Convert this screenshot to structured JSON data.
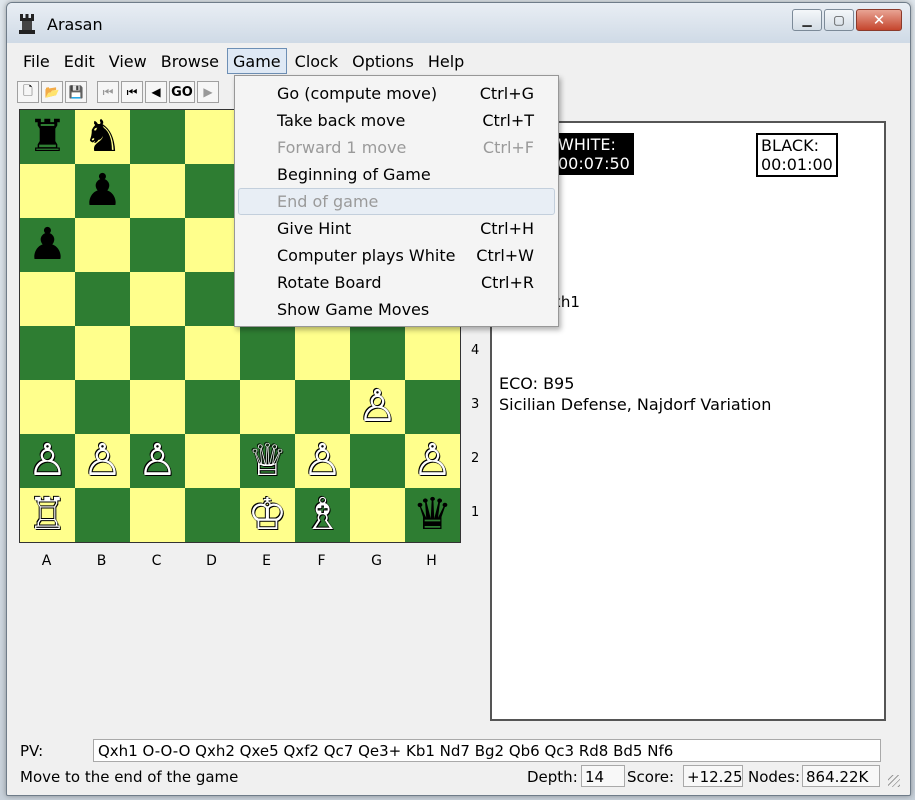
{
  "window": {
    "title": "Arasan"
  },
  "menu": {
    "file": "File",
    "edit": "Edit",
    "view": "View",
    "browse": "Browse",
    "game": "Game",
    "clock": "Clock",
    "options": "Options",
    "help": "Help"
  },
  "toolbar": {
    "go": "GO"
  },
  "game_menu": [
    {
      "label": "Go (compute move)",
      "shortcut": "Ctrl+G"
    },
    {
      "label": "Take back move",
      "shortcut": "Ctrl+T"
    },
    {
      "label": "Forward 1 move",
      "shortcut": "Ctrl+F"
    },
    {
      "label": "Beginning of Game",
      "shortcut": ""
    },
    {
      "label": "End of game",
      "shortcut": ""
    },
    {
      "label": "Give Hint",
      "shortcut": "Ctrl+H"
    },
    {
      "label": "Computer plays White",
      "shortcut": "Ctrl+W"
    },
    {
      "label": "Rotate Board",
      "shortcut": "Ctrl+R"
    },
    {
      "label": "Show Game Moves",
      "shortcut": ""
    }
  ],
  "board": {
    "files": [
      "A",
      "B",
      "C",
      "D",
      "E",
      "F",
      "G",
      "H"
    ],
    "visible_ranks": [
      "4",
      "3",
      "2",
      "1"
    ],
    "pieces": [
      {
        "square": "a8",
        "glyph": "♜",
        "color": "black"
      },
      {
        "square": "b8",
        "glyph": "♞",
        "color": "black"
      },
      {
        "square": "b7",
        "glyph": "♟",
        "color": "black"
      },
      {
        "square": "a6",
        "glyph": "♟",
        "color": "black"
      },
      {
        "square": "g3",
        "glyph": "♙",
        "color": "white"
      },
      {
        "square": "a2",
        "glyph": "♙",
        "color": "white"
      },
      {
        "square": "b2",
        "glyph": "♙",
        "color": "white"
      },
      {
        "square": "c2",
        "glyph": "♙",
        "color": "white"
      },
      {
        "square": "e2",
        "glyph": "♕",
        "color": "white"
      },
      {
        "square": "f2",
        "glyph": "♙",
        "color": "white"
      },
      {
        "square": "h2",
        "glyph": "♙",
        "color": "white"
      },
      {
        "square": "a1",
        "glyph": "♖",
        "color": "white"
      },
      {
        "square": "e1",
        "glyph": "♔",
        "color": "white"
      },
      {
        "square": "f1",
        "glyph": "♗",
        "color": "white"
      },
      {
        "square": "h1",
        "glyph": "♛",
        "color": "black"
      }
    ],
    "light_color": "#ffff8c",
    "dark_color": "#2e7d32"
  },
  "info": {
    "white_label": "WHITE:",
    "white_time": "00:07:50",
    "black_label": "BLACK:",
    "black_time": "00:01:00",
    "last_move": "xh1",
    "eco": "ECO: B95",
    "opening": "Sicilian Defense, Najdorf Variation"
  },
  "status": {
    "pv_label": "PV:",
    "pv": "Qxh1 O-O-O Qxh2 Qxe5 Qxf2 Qc7 Qe3+ Kb1 Nd7 Bg2 Qb6 Qc3 Rd8 Bd5 Nf6",
    "message": "Move to the end of the game",
    "depth_label": "Depth:",
    "depth": "14",
    "score_label": "Score:",
    "score": "+12.25",
    "nodes_label": "Nodes:",
    "nodes": "864.22K"
  }
}
